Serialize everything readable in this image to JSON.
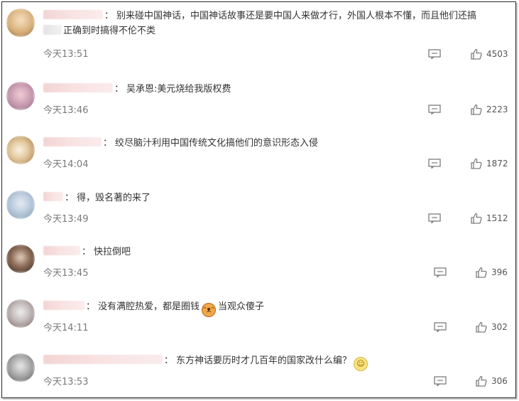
{
  "comments": [
    {
      "text": "别来碰中国神话，中国神话故事还是要中国人来做才行，外国人根本不懂，而且他们还搞",
      "text_cont": "正确到时搞得不伦不类",
      "time": "今天13:51",
      "likes": "4503",
      "avatar_colors": [
        "#f1d7b0",
        "#b88a5a"
      ],
      "user_width": 84
    },
    {
      "text": "吴承恩:美元烧给我版权费",
      "time": "今天13:46",
      "likes": "2223",
      "avatar_colors": [
        "#e8c5c5",
        "#9a6f8a"
      ],
      "user_width": 98
    },
    {
      "text": "绞尽脑汁利用中国传统文化搞他们的意识形态入侵",
      "time": "今天14:04",
      "likes": "1872",
      "avatar_colors": [
        "#e7d6b6",
        "#a67b45"
      ],
      "user_width": 82
    },
    {
      "text": "得，毁名著的来了",
      "time": "今天13:49",
      "likes": "1512",
      "avatar_colors": [
        "#cfd9e6",
        "#8aa1bf"
      ],
      "user_width": 28
    },
    {
      "text": "快拉倒吧",
      "time": "今天13:45",
      "likes": "396",
      "avatar_colors": [
        "#cdb8a8",
        "#5a4032"
      ],
      "user_width": 52
    },
    {
      "text_before": "没有满腔热爱，都是圈钱",
      "text_after": "当观众傻子",
      "time": "今天14:11",
      "likes": "302",
      "avatar_colors": [
        "#d8d8d8",
        "#7e6a6a"
      ],
      "user_width": 58
    },
    {
      "text": "东方神话要历时才几百年的国家改什么编？",
      "time": "今天13:53",
      "likes": "306",
      "avatar_colors": [
        "#cfcfcf",
        "#6d6d6d"
      ],
      "user_width": 168
    }
  ],
  "colon": "："
}
